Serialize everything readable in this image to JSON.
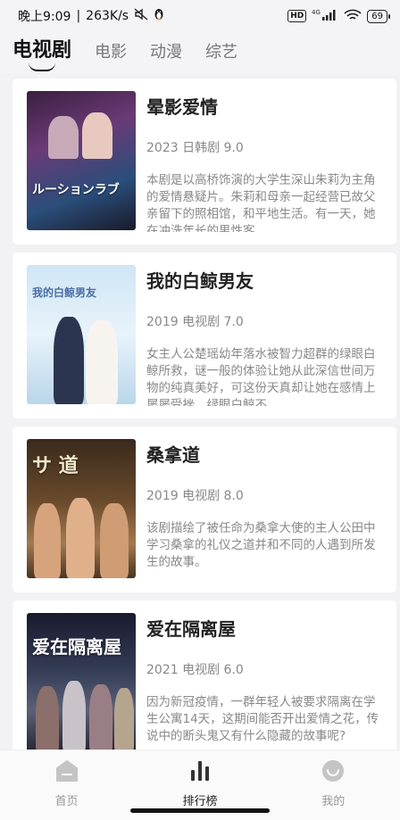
{
  "status": {
    "time": "晚上9:09",
    "speed": "263K/s",
    "network": "4G",
    "battery": "69"
  },
  "tabs": [
    {
      "label": "电视剧",
      "active": true
    },
    {
      "label": "电影",
      "active": false
    },
    {
      "label": "动漫",
      "active": false
    },
    {
      "label": "综艺",
      "active": false
    }
  ],
  "items": [
    {
      "title": "晕影爱情",
      "meta": "2023 日韩剧 9.0",
      "desc": "本剧是以高桥饰演的大学生深山朱莉为主角的爱情悬疑片。朱莉和母亲一起经营已故父亲留下的照相馆，和平地生活。有一天，她在冲洗年长的男性客…",
      "poster_text": "ルーションラブ"
    },
    {
      "title": "我的白鲸男友",
      "meta": "2019 电视剧 7.0",
      "desc": "女主人公楚瑶幼年落水被智力超群的绿眼白鲸所救，谜一般的体验让她从此深信世间万物的纯真美好，可这份天真却让她在感情上 屡屡受挫。绿眼白鲸不…",
      "poster_text": "我的白鲸男友"
    },
    {
      "title": "桑拿道",
      "meta": "2019 电视剧 8.0",
      "desc": "该剧描绘了被任命为桑拿大使的主人公田中学习桑拿的礼仪之道并和不同的人遇到所发生的故事。",
      "poster_text": "サ 道"
    },
    {
      "title": "爱在隔离屋",
      "meta": "2021 电视剧 6.0",
      "desc": "因为新冠疫情，一群年轻人被要求隔离在学生公寓14天，这期间能否开出爱情之花，传说中的断头鬼又有什么隐藏的故事呢?",
      "poster_text": "爱在隔离屋"
    }
  ],
  "nav": [
    {
      "label": "首页",
      "icon": "home-icon",
      "active": false
    },
    {
      "label": "排行榜",
      "icon": "chart-icon",
      "active": true
    },
    {
      "label": "我的",
      "icon": "profile-icon",
      "active": false
    }
  ],
  "colors": {
    "background": "#f2f2f4",
    "card": "#ffffff",
    "text_primary": "#222222",
    "text_secondary": "#888888"
  }
}
